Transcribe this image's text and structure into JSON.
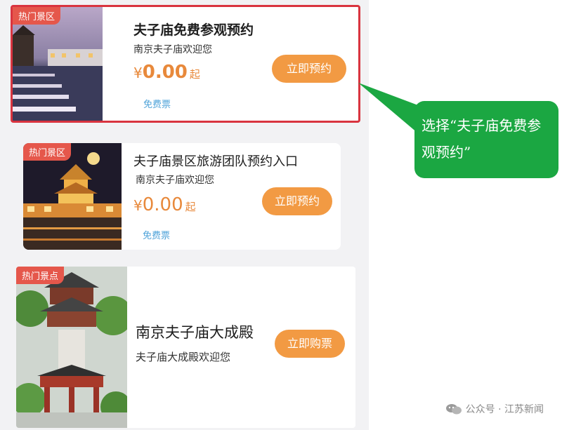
{
  "cards": [
    {
      "tag": "热门景区",
      "title": "夫子庙免费参观预约",
      "subtitle": "南京夫子庙欢迎您",
      "currency": "¥",
      "price": "0.00",
      "price_unit": "起",
      "ticket_type": "免费票",
      "button": "立即预约"
    },
    {
      "tag": "热门景区",
      "title": "夫子庙景区旅游团队预约入口",
      "subtitle": "南京夫子庙欢迎您",
      "currency": "¥",
      "price": "0.00",
      "price_unit": "起",
      "ticket_type": "免费票",
      "button": "立即预约"
    },
    {
      "tag": "热门景点",
      "title": "南京夫子庙大成殿",
      "subtitle": "夫子庙大成殿欢迎您",
      "button": "立即购票"
    }
  ],
  "callout": {
    "text": "选择“夫子庙免费参观预约”",
    "color": "#1ba742"
  },
  "footer": {
    "icon": "wechat-icon",
    "text": "公众号 · 江苏新闻"
  },
  "colors": {
    "highlight": "#d9343f",
    "tag": "#e5574b",
    "price": "#e8893b",
    "button": "#f29a43",
    "free_ticket": "#4fa3d9"
  }
}
